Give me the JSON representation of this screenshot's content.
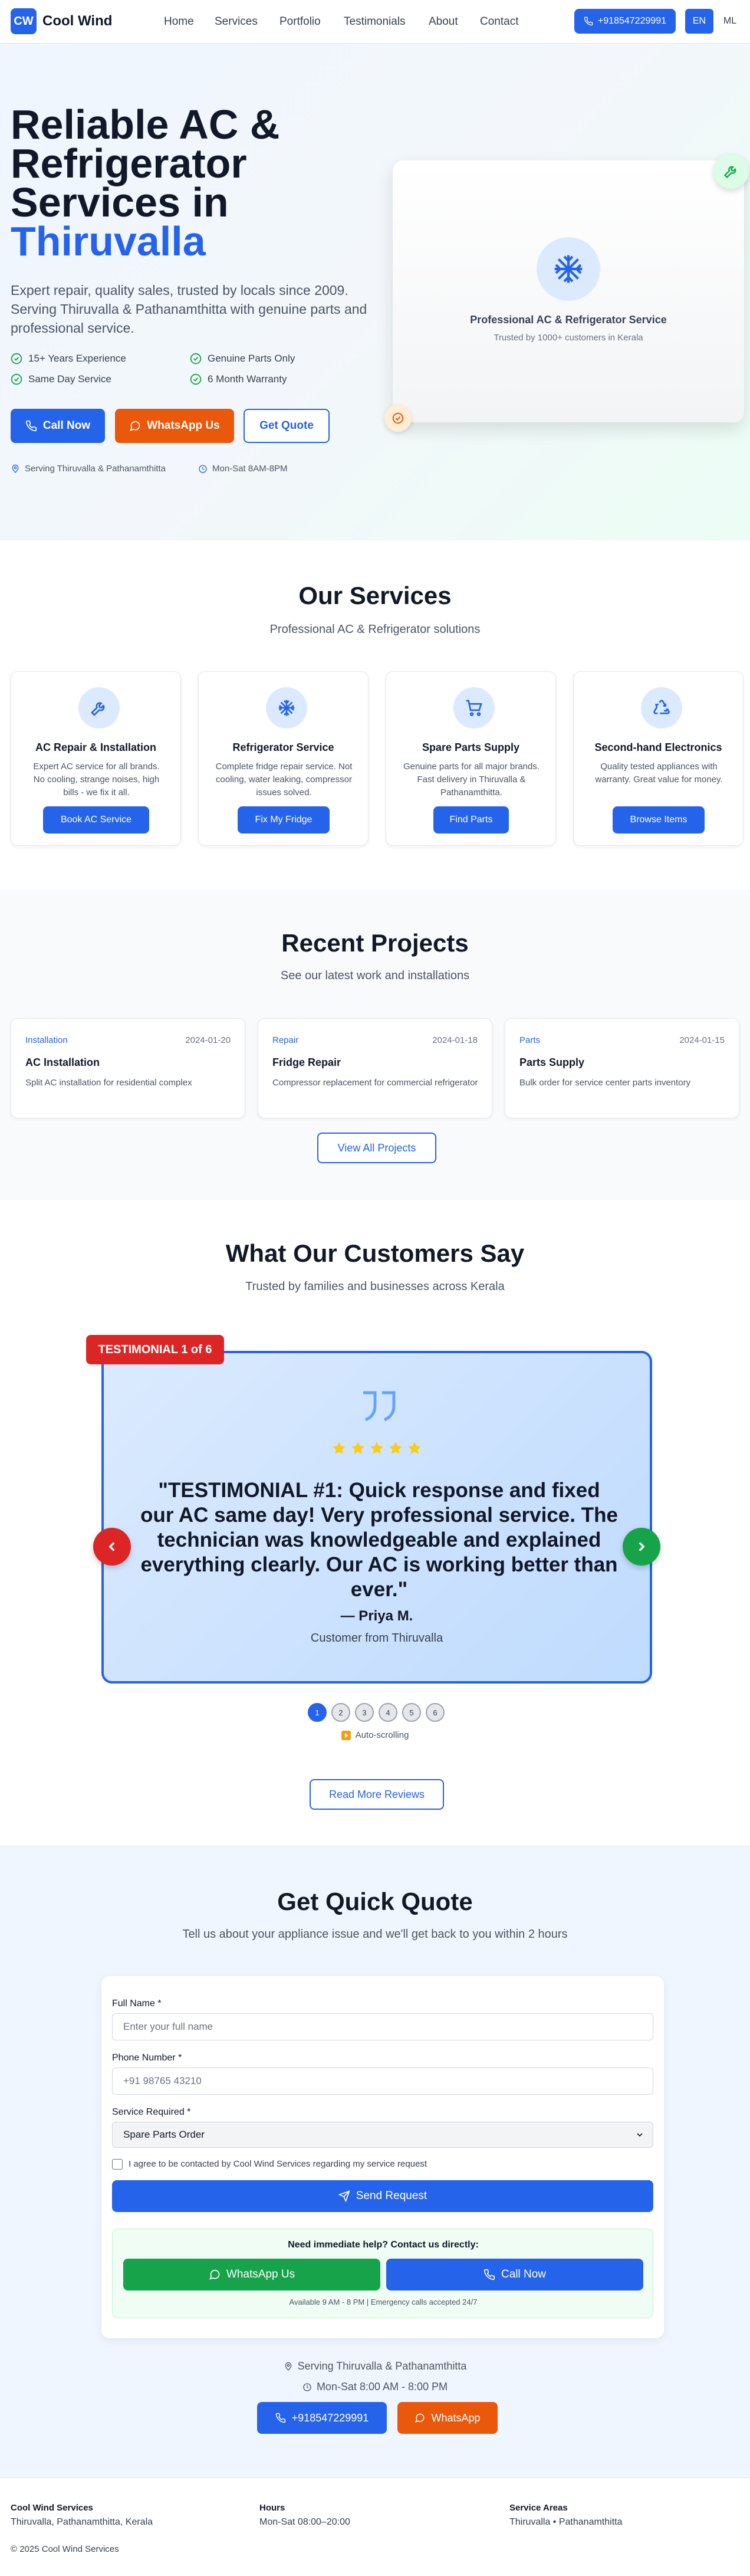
{
  "header": {
    "logo_mark": "CW",
    "brand": "Cool Wind",
    "nav": [
      "Home",
      "Services",
      "Portfolio",
      "Testimonials",
      "About",
      "Contact"
    ],
    "phone": "+918547229991",
    "lang_en": "EN",
    "lang_ml": "ML"
  },
  "hero": {
    "title_line1": "Reliable AC &",
    "title_line2": "Refrigerator",
    "title_line3": "Services in",
    "title_highlight": "Thiruvalla",
    "subtitle": "Expert repair, quality sales, trusted by locals since 2009. Serving Thiruvalla & Pathanamthitta with genuine parts and professional service.",
    "features": [
      "15+ Years Experience",
      "Genuine Parts Only",
      "Same Day Service",
      "6 Month Warranty"
    ],
    "btn_call": "Call Now",
    "btn_whatsapp": "WhatsApp Us",
    "btn_quote": "Get Quote",
    "meta_area": "Serving Thiruvalla & Pathanamthitta",
    "meta_hours": "Mon-Sat 8AM-8PM",
    "card_title": "Professional AC & Refrigerator Service",
    "card_sub": "Trusted by 1000+ customers in Kerala"
  },
  "services": {
    "title": "Our Services",
    "subtitle": "Professional AC & Refrigerator solutions",
    "items": [
      {
        "title": "AC Repair & Installation",
        "desc": "Expert AC service for all brands. No cooling, strange noises, high bills - we fix it all.",
        "btn": "Book AC Service",
        "icon": "wrench-icon"
      },
      {
        "title": "Refrigerator Service",
        "desc": "Complete fridge repair service. Not cooling, water leaking, compressor issues solved.",
        "btn": "Fix My Fridge",
        "icon": "snowflake-icon"
      },
      {
        "title": "Spare Parts Supply",
        "desc": "Genuine parts for all major brands. Fast delivery in Thiruvalla & Pathanamthitta.",
        "btn": "Find Parts",
        "icon": "cart-icon"
      },
      {
        "title": "Second-hand Electronics",
        "desc": "Quality tested appliances with warranty. Great value for money.",
        "btn": "Browse Items",
        "icon": "recycle-icon"
      }
    ]
  },
  "projects": {
    "title": "Recent Projects",
    "subtitle": "See our latest work and installations",
    "items": [
      {
        "tag": "Installation",
        "date": "2024-01-20",
        "title": "AC Installation",
        "desc": "Split AC installation for residential complex"
      },
      {
        "tag": "Repair",
        "date": "2024-01-18",
        "title": "Fridge Repair",
        "desc": "Compressor replacement for commercial refrigerator"
      },
      {
        "tag": "Parts",
        "date": "2024-01-15",
        "title": "Parts Supply",
        "desc": "Bulk order for service center parts inventory"
      }
    ],
    "btn_all": "View All Projects"
  },
  "testimonials": {
    "title": "What Our Customers Say",
    "subtitle": "Trusted by families and businesses across Kerala",
    "badge": "TESTIMONIAL 1 of 6",
    "quote": "\"TESTIMONIAL #1: Quick response and fixed our AC same day! Very professional service. The technician was knowledgeable and explained everything clearly. Our AC is working better than ever.\"",
    "author": "— Priya M.",
    "role": "Customer from Thiruvalla",
    "rating": 5,
    "dots": [
      "1",
      "2",
      "3",
      "4",
      "5",
      "6"
    ],
    "active_dot": 0,
    "auto_label": "Auto-scrolling",
    "btn_more": "Read More Reviews"
  },
  "quote": {
    "title": "Get Quick Quote",
    "subtitle": "Tell us about your appliance issue and we'll get back to you within 2 hours",
    "label_name": "Full Name *",
    "placeholder_name": "Enter your full name",
    "label_phone": "Phone Number *",
    "placeholder_phone": "+91 98765 43210",
    "label_service": "Service Required *",
    "service_value": "Spare Parts Order",
    "consent": "I agree to be contacted by Cool Wind Services regarding my service request",
    "submit": "Send Request",
    "help_title": "Need immediate help? Contact us directly:",
    "help_whatsapp": "WhatsApp Us",
    "help_call": "Call Now",
    "help_note": "Available 9 AM - 8 PM | Emergency calls accepted 24/7",
    "area": "Serving Thiruvalla & Pathanamthitta",
    "hours": "Mon-Sat 8:00 AM - 8:00 PM",
    "phone_btn": "+918547229991",
    "whatsapp_btn": "WhatsApp"
  },
  "footer": {
    "col1_title": "Cool Wind Services",
    "col1_text": "Thiruvalla, Pathanamthitta, Kerala",
    "col2_title": "Hours",
    "col2_text": "Mon-Sat 08:00–20:00",
    "col3_title": "Service Areas",
    "col3_text": "Thiruvalla • Pathanamthitta",
    "copyright": "© 2025 Cool Wind Services"
  },
  "colors": {
    "primary": "#2563eb",
    "whatsapp_orange": "#ea580c",
    "green": "#16a34a",
    "red": "#dc2626"
  }
}
